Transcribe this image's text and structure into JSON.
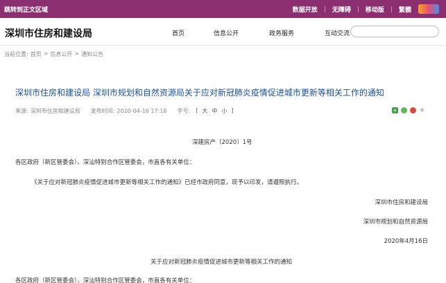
{
  "topbar": {
    "skip_link": "跳转到正文区域",
    "links": [
      "数据开放",
      "无障碍",
      "移动版",
      "繁體"
    ]
  },
  "header": {
    "site_title": "深圳市住房和建设局",
    "nav": [
      "首页",
      "信息公开",
      "政务服务",
      "互动交流"
    ],
    "search_placeholder": ""
  },
  "breadcrumb": {
    "label": "当前位置:",
    "items": [
      "首页",
      ">",
      "信息公开",
      ">",
      "通知公告"
    ]
  },
  "article": {
    "title": "深圳市住房和建设局 深圳市规划和自然资源局关于应对新冠肺炎疫情促进城市更新等相关工作的通知",
    "source_label": "来源:",
    "source": "深圳市住房和建设局",
    "date_label": "发布时间:",
    "date": "2020-04-16 17:18",
    "fontsize_label": "字号:",
    "fontsize_bracket_open": "[",
    "fontsize_options": [
      "大",
      "中",
      "小"
    ],
    "fontsize_bracket_close": "]",
    "doc_number": "深建房产〔2020〕1号",
    "addressee": "各区政府（新区管委会）、深汕特别合作区管委会，市直各有关单位：",
    "body": "《关于应对新冠肺炎疫情促进城市更新等相关工作的通知》已经市政府同意，现予以印发，请遵照执行。",
    "signer1": "深圳市住房和建设局",
    "signer2": "深圳市规划和自然资源局",
    "sign_date": "2020年4月16日",
    "attachment_title": "关于应对新冠肺炎疫情促进城市更新等相关工作的通知",
    "addressee2": "各区政府（新区管委会）、深汕特别合作区管委会，市直各有关单位："
  },
  "share_icons": [
    "plus-icon",
    "wechat-icon",
    "weibo-icon",
    "star-icon"
  ],
  "colors": {
    "topbar": "#8c2f71",
    "title": "#1a4f9c"
  }
}
